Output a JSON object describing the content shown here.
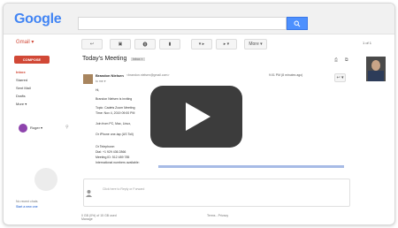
{
  "app": {
    "logo": "Google",
    "product": "Gmail ▾"
  },
  "toolbar": {
    "buttons": [
      "↩",
      "▣",
      "⓿",
      "▮",
      "▾ ▸",
      "▸ ▾",
      "More ▾"
    ],
    "pager": "1 of 1"
  },
  "sidebar": {
    "compose": "COMPOSE",
    "items": [
      "Inbox",
      "Starred",
      "Sent Mail",
      "Drafts",
      "More ▾"
    ],
    "hangouts_user": "Roger ▾",
    "note_1": "No recent chats",
    "note_2": "Start a new one"
  },
  "email": {
    "subject": "Today's Meeting",
    "tag": "Inbox ×",
    "sender": "Brandon Nielsen",
    "sender_email": "<brandon.nielsen@gmail.com>",
    "to": "to me ▾",
    "date": "9:01 PM (8 minutes ago)",
    "reply_icon": "↩ ▾",
    "lines": [
      "Hi,",
      "Brandon Nielsen is inviting",
      "Topic: Cadets Zoom Meeting",
      "Time: Nov 4, 2019 09:00 PM",
      "Join from PC, Mac, Linux,",
      "Or iPhone one-tap (US Toll)",
      "Or Telephone:",
      "Dial: +1 929 436 2866",
      "Meeting ID: 512 489 785",
      "International numbers available:"
    ],
    "reply_placeholder": "Click here to Reply or Forward"
  },
  "footer": {
    "storage": "0 GB (0%) of 15 GB used",
    "manage": "Manage",
    "terms": "Terms - Privacy"
  },
  "video": {
    "play": "play"
  }
}
